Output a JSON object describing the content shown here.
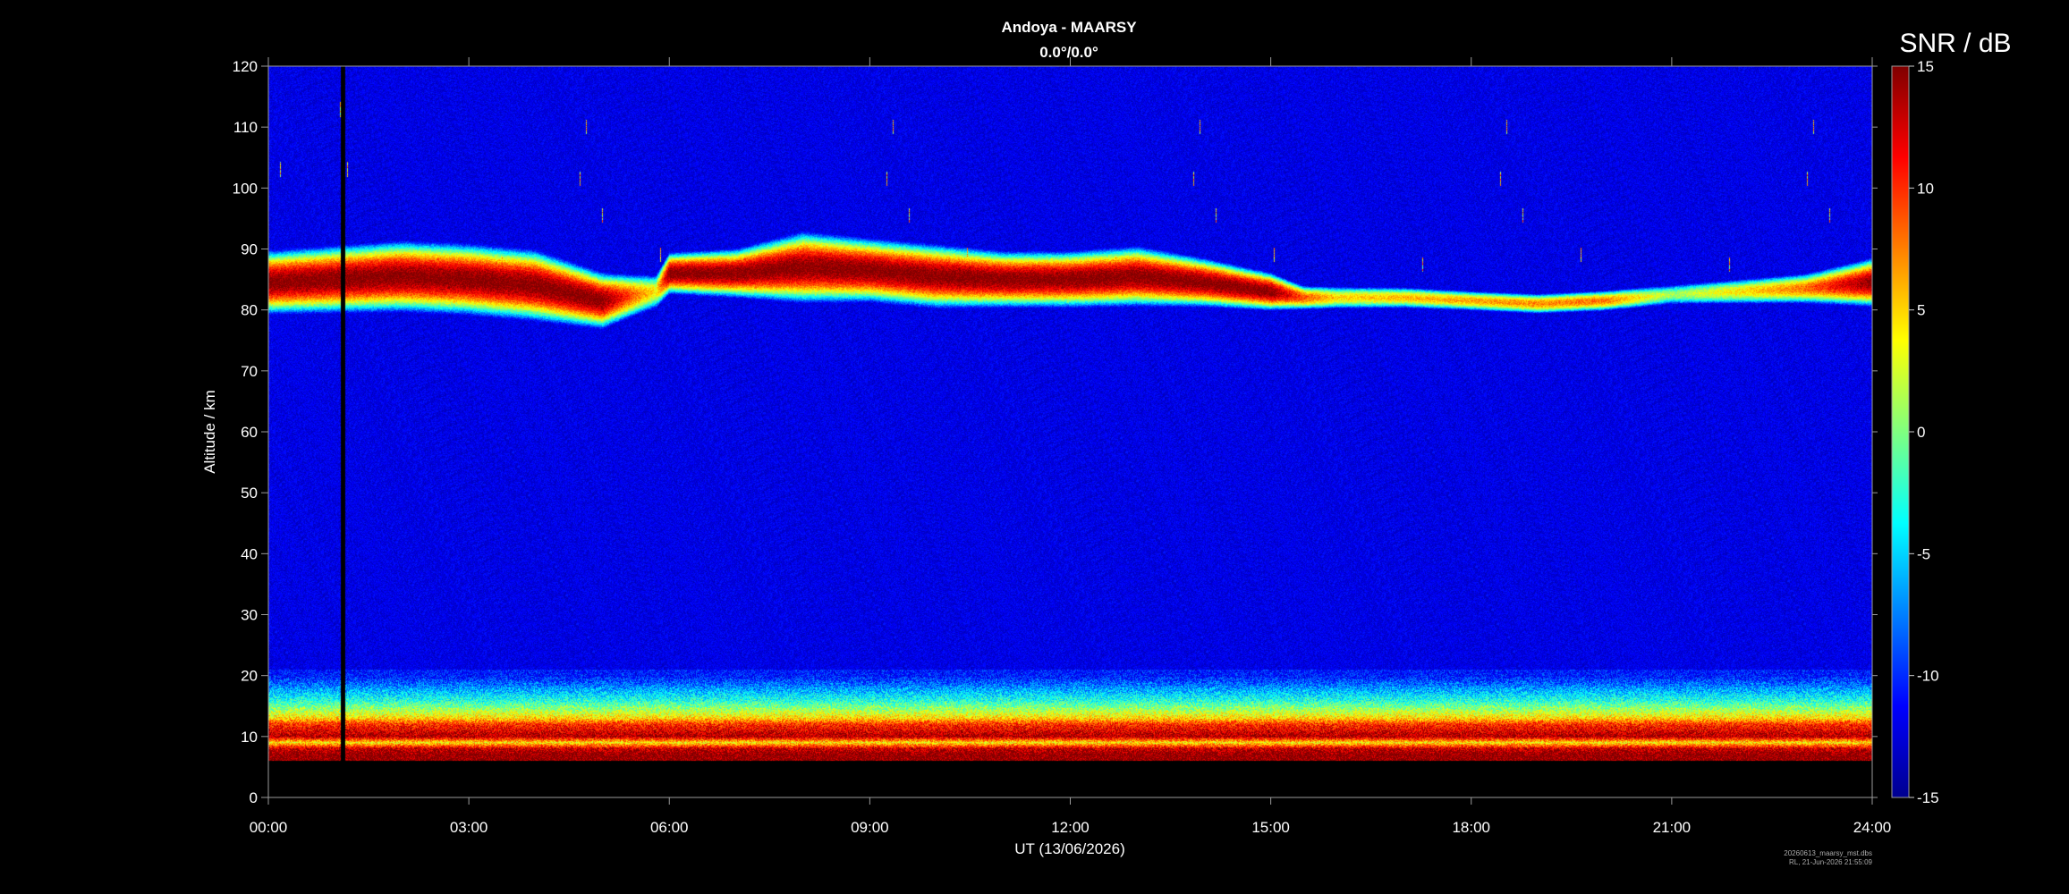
{
  "chart_data": {
    "type": "heatmap",
    "title": "Andoya - MAARSY",
    "subtitle": "0.0°/0.0°",
    "xlabel": "UT (13/06/2026)",
    "ylabel": "Altitude / km",
    "colorbar_label": "SNR / dB",
    "x_ticks": [
      "00:00",
      "03:00",
      "06:00",
      "09:00",
      "12:00",
      "15:00",
      "18:00",
      "21:00",
      "24:00"
    ],
    "x_range_hours": [
      0,
      24
    ],
    "y_ticks": [
      0,
      10,
      20,
      30,
      40,
      50,
      60,
      70,
      80,
      90,
      100,
      110,
      120
    ],
    "y_range_km": [
      0,
      120
    ],
    "colorbar_ticks": [
      -15,
      -10,
      -5,
      0,
      5,
      10,
      15
    ],
    "zlim_db": [
      -15,
      15
    ],
    "colormap": "jet",
    "background_snr_db": -12,
    "data_gap": {
      "start_hour": 1.08,
      "end_hour": 1.15
    },
    "layers": [
      {
        "name": "PMSE",
        "center_km": [
          [
            0,
            84.5
          ],
          [
            1,
            85
          ],
          [
            2,
            85.5
          ],
          [
            3,
            85
          ],
          [
            4,
            84
          ],
          [
            5,
            81.5
          ],
          [
            5.8,
            83
          ],
          [
            6,
            86
          ],
          [
            7,
            86
          ],
          [
            8,
            87
          ],
          [
            9,
            86.5
          ],
          [
            10,
            85.5
          ],
          [
            11,
            85
          ],
          [
            12,
            85
          ],
          [
            13,
            85.5
          ],
          [
            14,
            84.5
          ],
          [
            15,
            83
          ],
          [
            15.5,
            82
          ],
          [
            16,
            82
          ],
          [
            17,
            82
          ],
          [
            18,
            81.5
          ],
          [
            19,
            81
          ],
          [
            20,
            81.5
          ],
          [
            21,
            82.5
          ],
          [
            22,
            83
          ],
          [
            23,
            83.5
          ],
          [
            24,
            84.5
          ]
        ],
        "thickness_km": [
          [
            0,
            7
          ],
          [
            1,
            7.5
          ],
          [
            2,
            8
          ],
          [
            3,
            8
          ],
          [
            4,
            8
          ],
          [
            5,
            6
          ],
          [
            5.8,
            4
          ],
          [
            6,
            4
          ],
          [
            7,
            5
          ],
          [
            8,
            8
          ],
          [
            9,
            7
          ],
          [
            10,
            7
          ],
          [
            11,
            6
          ],
          [
            12,
            6
          ],
          [
            13,
            6.5
          ],
          [
            14,
            5
          ],
          [
            15,
            3.5
          ],
          [
            15.5,
            2
          ],
          [
            16,
            2
          ],
          [
            18,
            1.5
          ],
          [
            20,
            1.5
          ],
          [
            21,
            2
          ],
          [
            22,
            2.5
          ],
          [
            23,
            3
          ],
          [
            24,
            5
          ]
        ],
        "peak_snr_db": [
          [
            0,
            15
          ],
          [
            5,
            15
          ],
          [
            5.8,
            4
          ],
          [
            6,
            15
          ],
          [
            15,
            15
          ],
          [
            15.5,
            9
          ],
          [
            16,
            5
          ],
          [
            20,
            8
          ],
          [
            21,
            1
          ],
          [
            23,
            8
          ],
          [
            24,
            15
          ]
        ]
      },
      {
        "name": "lower-atmosphere",
        "bottom_km": 6,
        "top_km": 20,
        "profile_snr_db": [
          [
            6,
            15
          ],
          [
            7,
            15
          ],
          [
            8,
            13
          ],
          [
            9,
            4
          ],
          [
            10,
            14
          ],
          [
            11,
            12
          ],
          [
            12,
            10
          ],
          [
            13,
            5
          ],
          [
            14,
            2
          ],
          [
            16,
            -3
          ],
          [
            18,
            -7
          ],
          [
            20,
            -11
          ]
        ]
      }
    ]
  },
  "footer": {
    "file_name": "20260613_maarsy_mst.dbs",
    "created": "RL, 21-Jun-2026 21:55:09"
  }
}
